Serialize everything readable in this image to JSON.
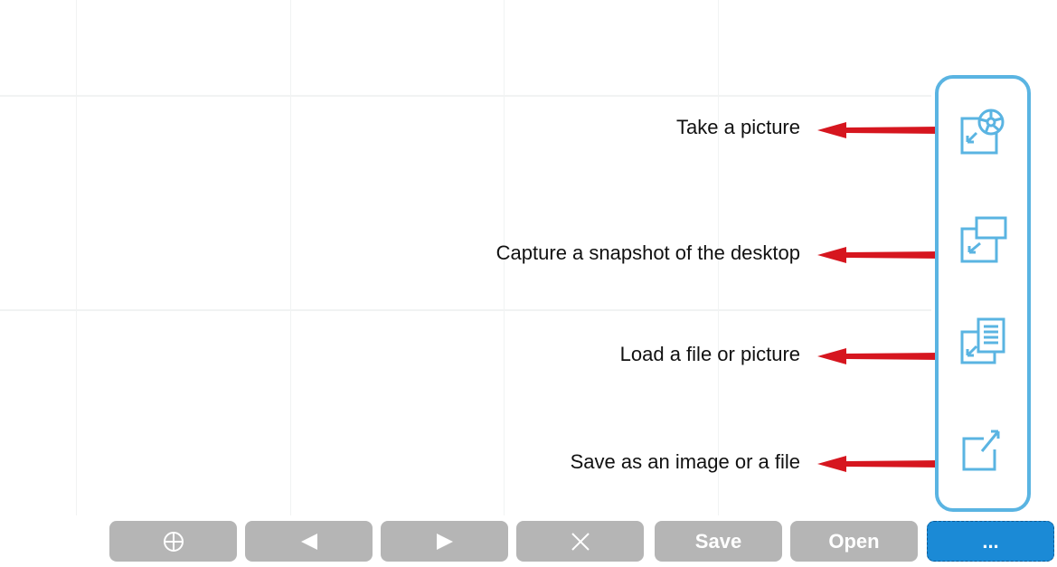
{
  "callouts": [
    {
      "label": "Take a picture"
    },
    {
      "label": "Capture a snapshot of the desktop"
    },
    {
      "label": "Load a file or picture"
    },
    {
      "label": "Save as an image or a file"
    }
  ],
  "side_panel": {
    "tools": [
      {
        "name": "camera-icon"
      },
      {
        "name": "desktop-snapshot-icon"
      },
      {
        "name": "load-file-icon"
      },
      {
        "name": "save-export-icon"
      }
    ]
  },
  "toolbar": {
    "add_icon": "add-icon",
    "prev_icon": "previous-icon",
    "next_icon": "next-icon",
    "close_icon": "close-icon",
    "save_label": "Save",
    "open_label": "Open",
    "more_label": "..."
  },
  "colors": {
    "panel_border": "#5ab4e2",
    "icon": "#5ab4e2",
    "arrow": "#d6161f",
    "button": "#b5b5b5",
    "button_active": "#1b8ad6"
  }
}
